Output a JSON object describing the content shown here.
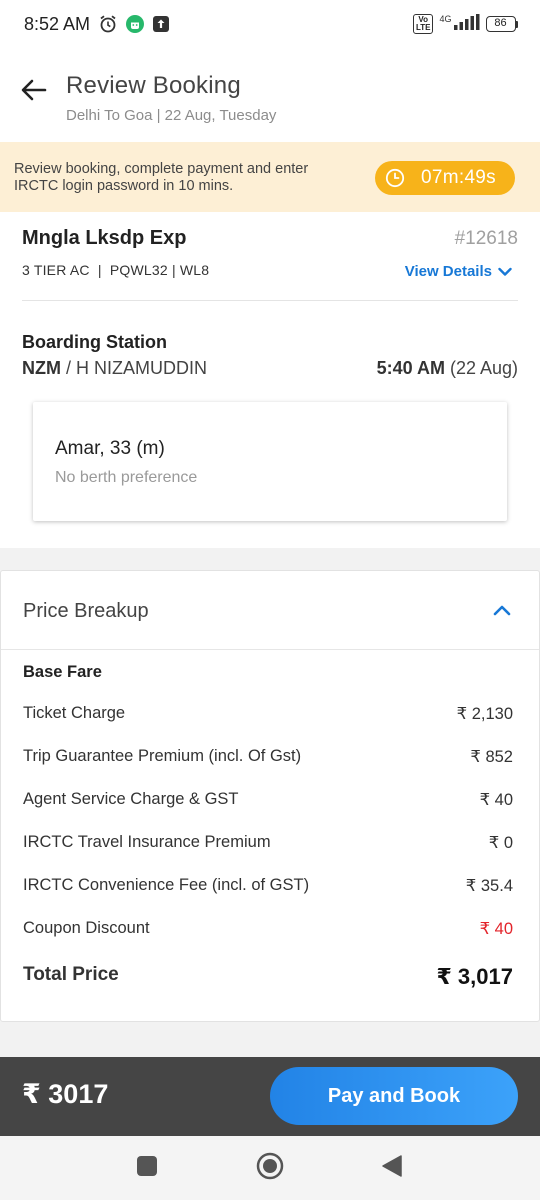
{
  "status_bar": {
    "time": "8:52 AM",
    "volte_label": "Vo\nLTE",
    "network": "4G",
    "battery": "86"
  },
  "header": {
    "title": "Review Booking",
    "subtitle": "Delhi To Goa | 22 Aug, Tuesday"
  },
  "timer_banner": {
    "message": "Review booking, complete payment and enter IRCTC login password in 10 mins.",
    "countdown": "07m:49s"
  },
  "train": {
    "name": "Mngla Lksdp Exp",
    "number": "#12618",
    "meta": "3 TIER AC  |  PQWL32 | WL8",
    "view_details": "View Details"
  },
  "boarding": {
    "label": "Boarding Station",
    "station_code": "NZM",
    "station_sep": " / ",
    "station_name": "H NIZAMUDDIN",
    "time": "5:40 AM",
    "date": " (22 Aug)"
  },
  "passenger": {
    "name": "Amar, 33 (m)",
    "preference": "No berth preference"
  },
  "price": {
    "heading": "Price Breakup",
    "section": "Base Fare",
    "rows": [
      {
        "label": "Ticket Charge",
        "amount": "₹ 2,130"
      },
      {
        "label": "Trip Guarantee Premium (incl. Of Gst)",
        "amount": "₹ 852"
      },
      {
        "label": "Agent Service Charge & GST",
        "amount": "₹ 40"
      },
      {
        "label": "IRCTC Travel Insurance Premium",
        "amount": "₹ 0"
      },
      {
        "label": "IRCTC Convenience Fee (incl. of GST)",
        "amount": "₹ 35.4"
      },
      {
        "label": "Coupon Discount",
        "amount": "₹ 40"
      }
    ],
    "total_label": "Total Price",
    "total_amount": "₹ 3,017"
  },
  "bottom": {
    "total": "₹ 3017",
    "pay_label": "Pay and Book"
  },
  "colors": {
    "accent": "#1778d6",
    "timer": "#f7b31a",
    "discount": "#e3242b",
    "bottom_bar": "#454545"
  }
}
